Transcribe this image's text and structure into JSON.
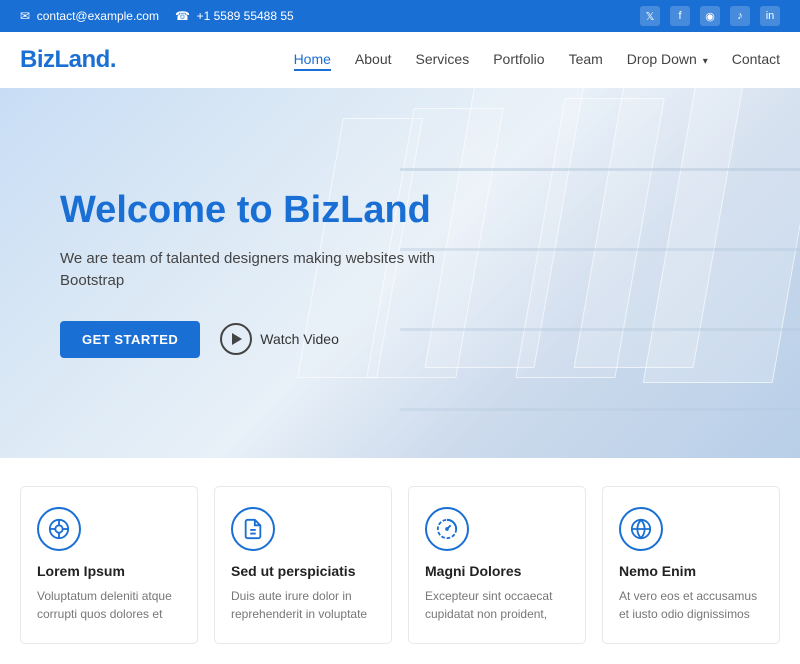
{
  "topbar": {
    "email": "contact@example.com",
    "phone": "+1 5589 55488 55",
    "email_icon": "✉",
    "phone_icon": "☎",
    "socials": [
      "t",
      "f",
      "o",
      "♪",
      "in"
    ]
  },
  "navbar": {
    "logo_text": "BizLand",
    "logo_dot": ".",
    "links": [
      {
        "label": "Home",
        "active": true
      },
      {
        "label": "About",
        "active": false
      },
      {
        "label": "Services",
        "active": false
      },
      {
        "label": "Portfolio",
        "active": false
      },
      {
        "label": "Team",
        "active": false
      },
      {
        "label": "Drop Down",
        "active": false,
        "has_dropdown": true
      },
      {
        "label": "Contact",
        "active": false
      }
    ]
  },
  "hero": {
    "title_plain": "Welcome to ",
    "title_brand": "BizLand",
    "subtitle": "We are team of talanted designers making websites with Bootstrap",
    "btn_primary": "GET STARTED",
    "btn_video": "Watch Video"
  },
  "features": [
    {
      "title": "Lorem Ipsum",
      "desc": "Voluptatum deleniti atque corrupti quos dolores et",
      "icon_type": "dribbble"
    },
    {
      "title": "Sed ut perspiciatis",
      "desc": "Duis aute irure dolor in reprehenderit in voluptate",
      "icon_type": "document"
    },
    {
      "title": "Magni Dolores",
      "desc": "Excepteur sint occaecat cupidatat non proident,",
      "icon_type": "speedometer"
    },
    {
      "title": "Nemo Enim",
      "desc": "At vero eos et accusamus et iusto odio dignissimos",
      "icon_type": "globe"
    }
  ]
}
